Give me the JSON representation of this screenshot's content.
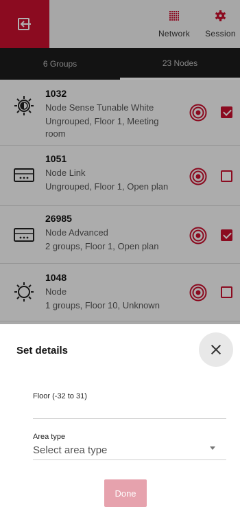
{
  "topbar": {
    "network_label": "Network",
    "session_label": "Session",
    "icons": {
      "back": "exit-icon",
      "network": "grid-icon",
      "session": "gear-icon"
    }
  },
  "tabs": [
    {
      "label": "6 Groups",
      "active": false
    },
    {
      "label": "23 Nodes",
      "active": true
    }
  ],
  "nodes": [
    {
      "id": "1032",
      "type": "Node Sense Tunable White",
      "location_line1": "Ungrouped, Floor 1, Meeting",
      "location_line2": "room",
      "icon": "sun-half-icon",
      "checked": true
    },
    {
      "id": "1051",
      "type": "Node Link",
      "location_line1": "Ungrouped, Floor 1, Open plan",
      "icon": "link-device-icon",
      "checked": false
    },
    {
      "id": "26985",
      "type": "Node Advanced",
      "location_line1": "2 groups, Floor 1, Open plan",
      "icon": "link-device-icon",
      "checked": true
    },
    {
      "id": "1048",
      "type": "Node",
      "location_line1": "1 groups, Floor 10, Unknown",
      "icon": "sun-icon",
      "checked": false
    }
  ],
  "sheet": {
    "title": "Set details",
    "floor_label": "Floor (-32 to 31)",
    "floor_value": "",
    "area_label": "Area type",
    "area_placeholder": "Select area type",
    "done_label": "Done"
  },
  "colors": {
    "accent": "#c8102e",
    "done_disabled": "#e6a2ad",
    "tabbar": "#1c1c1c"
  }
}
